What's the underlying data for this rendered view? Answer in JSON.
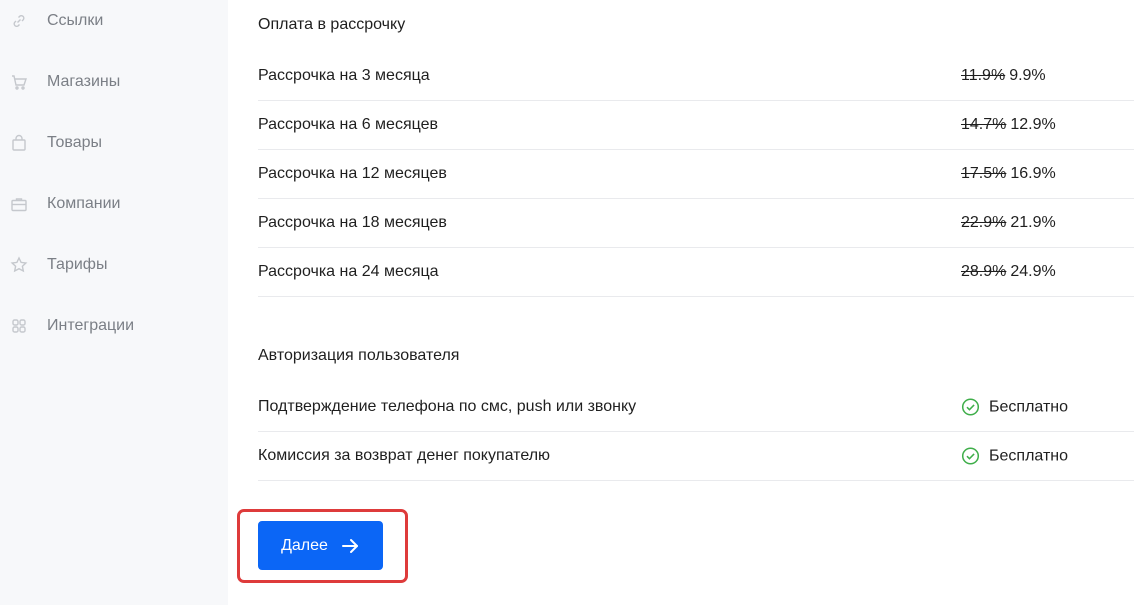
{
  "sidebar": {
    "items": [
      {
        "label": "Ссылки",
        "icon": "link-icon"
      },
      {
        "label": "Магазины",
        "icon": "cart-icon"
      },
      {
        "label": "Товары",
        "icon": "bag-icon"
      },
      {
        "label": "Компании",
        "icon": "briefcase-icon"
      },
      {
        "label": "Тарифы",
        "icon": "star-icon"
      },
      {
        "label": "Интеграции",
        "icon": "grid-icon"
      }
    ]
  },
  "installments": {
    "title": "Оплата в рассрочку",
    "rows": [
      {
        "name": "Рассрочка на 3 месяца",
        "old_rate": "11.9%",
        "new_rate": "9.9%"
      },
      {
        "name": "Рассрочка на 6 месяцев",
        "old_rate": "14.7%",
        "new_rate": "12.9%"
      },
      {
        "name": "Рассрочка на 12 месяцев",
        "old_rate": "17.5%",
        "new_rate": "16.9%"
      },
      {
        "name": "Рассрочка на 18 месяцев",
        "old_rate": "22.9%",
        "new_rate": "21.9%"
      },
      {
        "name": "Рассрочка на 24 месяца",
        "old_rate": "28.9%",
        "new_rate": "24.9%"
      }
    ]
  },
  "auth": {
    "title": "Авторизация пользователя",
    "rows": [
      {
        "name": "Подтверждение телефона по смс, push или звонку",
        "value": "Бесплатно"
      },
      {
        "name": "Комиссия за возврат денег покупателю",
        "value": "Бесплатно"
      }
    ]
  },
  "next_button": {
    "label": "Далее",
    "icon": "arrow-right-icon"
  },
  "colors": {
    "accent": "#0b66f6",
    "highlight": "#de3b3b",
    "check": "#3fae4a",
    "sidebar_bg": "#f7f8fa"
  }
}
